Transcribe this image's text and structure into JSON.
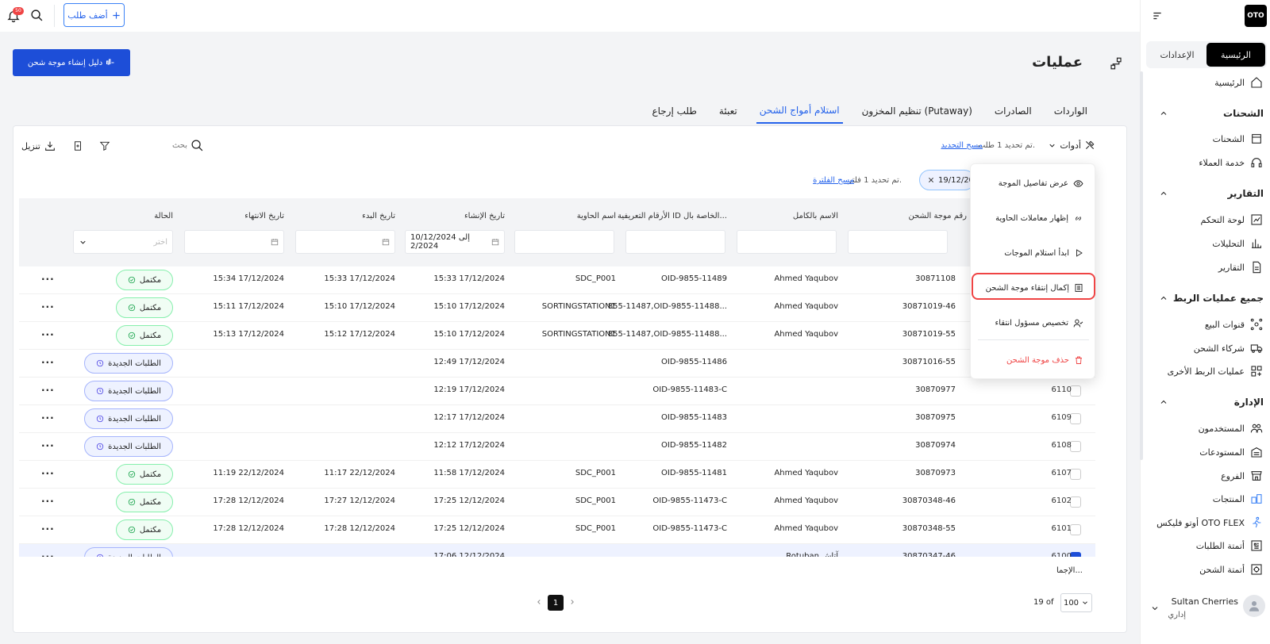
{
  "topbar": {
    "add_order_label": "أضف طلب",
    "notification_count": "50"
  },
  "sidebar": {
    "logo": "OTO",
    "tabs": [
      {
        "label": "الرئيسية",
        "active": true
      },
      {
        "label": "الإعدادات",
        "active": false
      }
    ],
    "home": {
      "label": "الرئيسية",
      "icon": "home-icon"
    },
    "sections": [
      {
        "title": "الشحنات",
        "items": [
          {
            "label": "الشحنات",
            "icon": "box-icon"
          },
          {
            "label": "خدمة العملاء",
            "icon": "headset-icon"
          }
        ]
      },
      {
        "title": "التقارير",
        "items": [
          {
            "label": "لوحة التحكم",
            "icon": "dashboard-icon"
          },
          {
            "label": "التحليلات",
            "icon": "analytics-icon"
          },
          {
            "label": "التقارير",
            "icon": "report-icon"
          }
        ]
      },
      {
        "title": "جميع عمليات الربط",
        "items": [
          {
            "label": "قنوات البيع",
            "icon": "channels-icon"
          },
          {
            "label": "شركاء الشحن",
            "icon": "truck-icon"
          },
          {
            "label": "عمليات الربط الأخرى",
            "icon": "grid-plus-icon"
          }
        ]
      },
      {
        "title": "الإدارة",
        "items": [
          {
            "label": "المستخدمون",
            "icon": "users-icon"
          },
          {
            "label": "المستودعات",
            "icon": "warehouse-icon"
          },
          {
            "label": "الفروع",
            "icon": "store-icon"
          },
          {
            "label": "المنتجات",
            "icon": "products-icon"
          },
          {
            "label": "أوتو فليكس OTO FLEX",
            "icon": "runner-icon"
          },
          {
            "label": "أتمتة الطلبات",
            "icon": "automation-icon"
          },
          {
            "label": "أتمتة الشحن",
            "icon": "shipping-automation-icon"
          }
        ]
      }
    ],
    "user": {
      "name": "Sultan Cherries",
      "role": "إداري"
    }
  },
  "header": {
    "title": "عمليات",
    "guide_button": "دليل إنشاء موجة شحن"
  },
  "tabs": [
    {
      "label": "الواردات",
      "active": false
    },
    {
      "label": "الصادرات",
      "active": false
    },
    {
      "label": "تنظيم المخزون (Putaway)",
      "active": false
    },
    {
      "label": "استلام أمواج الشحن",
      "active": true
    },
    {
      "label": "تعبئة",
      "active": false
    },
    {
      "label": "طلب إرجاع",
      "active": false
    }
  ],
  "toolbar": {
    "download": "تنزيل",
    "search_placeholder": "بحث",
    "tools": "أدوات",
    "selected_text": "تم تحديد 1 طلب.",
    "clear_selection": "مسح التحديد",
    "filter_text": "تم تحديد 1 فلتر.",
    "clear_filter": "مسح الفلترة",
    "filter_chip": "19/12/20"
  },
  "table": {
    "headers": {
      "wave": "رقم موجة الشحن",
      "name": "الاسم بالكامل",
      "ids": "الأرقام التعريفية ID الخاصة بال...",
      "container": "اسم الحاوية",
      "created": "تاريخ الإنشاء",
      "start": "تاريخ البدء",
      "end": "تاريخ الانتهاء",
      "status": "الحالة"
    },
    "created_filter": "10/12/2024 إلى 2/2024",
    "status_placeholder": "اختر",
    "rows": [
      {
        "id": "",
        "wave": "30871108",
        "name": "Ahmed Yaqubov",
        "ids": "OID-9855-11489",
        "container": "SDC_P001",
        "created": "15:33 17/12/2024",
        "start": "15:33 17/12/2024",
        "end": "15:34 17/12/2024",
        "status": "مكتمل",
        "kind": "done",
        "selected": false
      },
      {
        "id": "",
        "wave": "30871019-46",
        "name": "Ahmed Yaqubov",
        "ids": "855-11487,OID-9855-11488...",
        "container": "SORTINGSTATION1",
        "created": "15:10 17/12/2024",
        "start": "15:10 17/12/2024",
        "end": "15:11 17/12/2024",
        "status": "مكتمل",
        "kind": "done",
        "selected": false
      },
      {
        "id": "",
        "wave": "30871019-55",
        "name": "Ahmed Yaqubov",
        "ids": "855-11487,OID-9855-11488...",
        "container": "SORTINGSTATION1",
        "created": "15:10 17/12/2024",
        "start": "15:12 17/12/2024",
        "end": "15:13 17/12/2024",
        "status": "مكتمل",
        "kind": "done",
        "selected": false
      },
      {
        "id": "",
        "wave": "30871016-55",
        "name": "",
        "ids": "OID-9855-11486",
        "container": "",
        "created": "12:49 17/12/2024",
        "start": "",
        "end": "",
        "status": "الطلبات الجديدة",
        "kind": "new",
        "selected": false
      },
      {
        "id": "6110",
        "wave": "30870977",
        "name": "",
        "ids": "OID-9855-11483-C",
        "container": "",
        "created": "12:19 17/12/2024",
        "start": "",
        "end": "",
        "status": "الطلبات الجديدة",
        "kind": "new",
        "selected": false
      },
      {
        "id": "6109",
        "wave": "30870975",
        "name": "",
        "ids": "OID-9855-11483",
        "container": "",
        "created": "12:17 17/12/2024",
        "start": "",
        "end": "",
        "status": "الطلبات الجديدة",
        "kind": "new",
        "selected": false
      },
      {
        "id": "6108",
        "wave": "30870974",
        "name": "",
        "ids": "OID-9855-11482",
        "container": "",
        "created": "12:12 17/12/2024",
        "start": "",
        "end": "",
        "status": "الطلبات الجديدة",
        "kind": "new",
        "selected": false
      },
      {
        "id": "6107",
        "wave": "30870973",
        "name": "Ahmed Yaqubov",
        "ids": "OID-9855-11481",
        "container": "SDC_P001",
        "created": "11:58 17/12/2024",
        "start": "11:17 22/12/2024",
        "end": "11:19 22/12/2024",
        "status": "مكتمل",
        "kind": "done",
        "selected": false
      },
      {
        "id": "6102",
        "wave": "30870348-46",
        "name": "Ahmed Yaqubov",
        "ids": "OID-9855-11473-C",
        "container": "SDC_P001",
        "created": "17:25 12/12/2024",
        "start": "17:27 12/12/2024",
        "end": "17:28 12/12/2024",
        "status": "مكتمل",
        "kind": "done",
        "selected": false
      },
      {
        "id": "6101",
        "wave": "30870348-55",
        "name": "Ahmed Yaqubov",
        "ids": "OID-9855-11473-C",
        "container": "SDC_P001",
        "created": "17:25 12/12/2024",
        "start": "17:28 12/12/2024",
        "end": "17:28 12/12/2024",
        "status": "مكتمل",
        "kind": "done",
        "selected": false
      },
      {
        "id": "6100",
        "wave": "30870347-46",
        "name": "Rotuban آتاش",
        "ids": "",
        "container": "",
        "created": "17:06 12/12/2024",
        "start": "",
        "end": "",
        "status": "الطلبات الجديدة",
        "kind": "new",
        "selected": true
      }
    ]
  },
  "footer": {
    "total_label": "الإجما...",
    "per_page": "100",
    "of_label": "19 of",
    "current_page": "1"
  },
  "tools_menu": {
    "items": [
      {
        "label": "عرض تفاصيل الموجة",
        "icon": "eye-icon"
      },
      {
        "label": "إظهار معاملات الحاوية",
        "icon": "link-icon"
      },
      {
        "label": "ابدأ استلام الموجات",
        "icon": "play-icon"
      },
      {
        "label": "إكمال إنتقاء موجة الشحن",
        "icon": "list-icon"
      },
      {
        "label": "تخصيص مسؤول انتقاء",
        "icon": "user-check-icon"
      },
      {
        "label": "حذف موجة الشحن",
        "icon": "trash-icon"
      }
    ]
  },
  "colors": {
    "accent": "#2563eb",
    "primary_button": "#1d4ed8",
    "danger": "#ef4444",
    "done_badge": "#22c55e",
    "new_badge": "#4f46e5"
  }
}
